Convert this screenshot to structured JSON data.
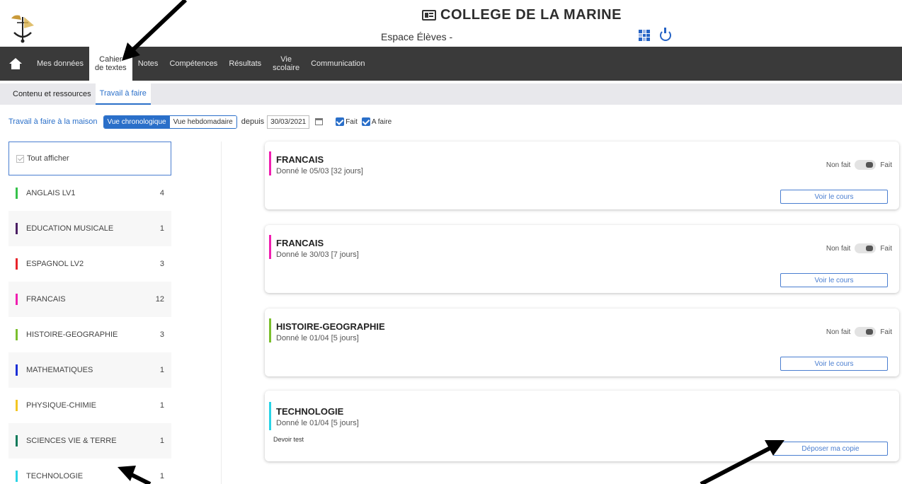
{
  "header": {
    "school_name": "COLLEGE DE LA MARINE",
    "space": "Espace Élèves -"
  },
  "nav": {
    "items": [
      {
        "label": "Mes données"
      },
      {
        "line1": "Cahier",
        "line2": "de textes"
      },
      {
        "label": "Notes"
      },
      {
        "label": "Compétences"
      },
      {
        "label": "Résultats"
      },
      {
        "line1": "Vie",
        "line2": "scolaire"
      },
      {
        "label": "Communication"
      }
    ]
  },
  "subtabs": [
    "Contenu et ressources",
    "Travail à faire"
  ],
  "filters": {
    "link": "Travail à faire à la maison",
    "view_chrono": "Vue chronologique",
    "view_weekly": "Vue hebdomadaire",
    "since": "depuis",
    "date": "30/03/2021",
    "done": "Fait",
    "todo": "A faire"
  },
  "sidebar": {
    "show_all": "Tout afficher",
    "items": [
      {
        "label": "ANGLAIS LV1",
        "count": "4",
        "color": "#36c24a"
      },
      {
        "label": "EDUCATION MUSICALE",
        "count": "1",
        "color": "#4b1f63"
      },
      {
        "label": "ESPAGNOL LV2",
        "count": "3",
        "color": "#e8242a"
      },
      {
        "label": "FRANCAIS",
        "count": "12",
        "color": "#f01fb0"
      },
      {
        "label": "HISTOIRE-GEOGRAPHIE",
        "count": "3",
        "color": "#7bbf2e"
      },
      {
        "label": "MATHEMATIQUES",
        "count": "1",
        "color": "#1b2fd6"
      },
      {
        "label": "PHYSIQUE-CHIMIE",
        "count": "1",
        "color": "#f3c623"
      },
      {
        "label": "SCIENCES VIE & TERRE",
        "count": "1",
        "color": "#0e7a5a"
      },
      {
        "label": "TECHNOLOGIE",
        "count": "1",
        "color": "#2ad4e6"
      }
    ]
  },
  "cards": [
    {
      "subject": "FRANCAIS",
      "given": "Donné le 05/03 [32 jours]",
      "off": "Non fait",
      "on": "Fait",
      "button": "Voir le cours",
      "color": "#f01fb0"
    },
    {
      "subject": "FRANCAIS",
      "given": "Donné le 30/03 [7 jours]",
      "off": "Non fait",
      "on": "Fait",
      "button": "Voir le cours",
      "color": "#f01fb0"
    },
    {
      "subject": "HISTOIRE-GEOGRAPHIE",
      "given": "Donné le 01/04 [5 jours]",
      "off": "Non fait",
      "on": "Fait",
      "button": "Voir le cours",
      "color": "#7bbf2e"
    },
    {
      "subject": "TECHNOLOGIE",
      "given": "Donné le 01/04 [5 jours]",
      "note": "Devoir test",
      "button": "Déposer ma copie",
      "color": "#2ad4e6"
    }
  ],
  "colors": {
    "accent": "#2a6fc9",
    "navbar": "#3a3a3a"
  }
}
